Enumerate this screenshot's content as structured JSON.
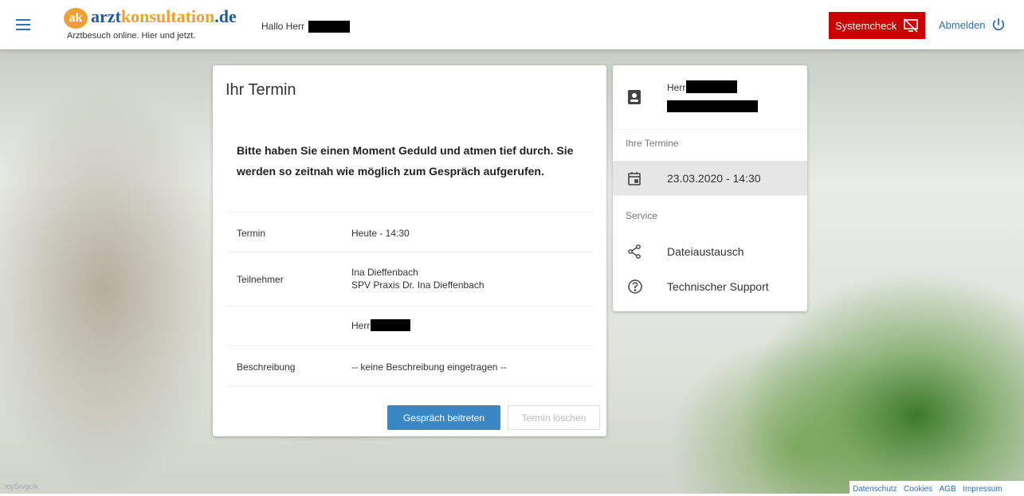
{
  "header": {
    "brand_ak": "ak",
    "brand_part1": "arzt",
    "brand_part2": "konsultation",
    "brand_part3": ".de",
    "tagline": "Arztbesuch online. Hier und jetzt.",
    "greeting": "Hallo Herr",
    "syscheck_label": "Systemcheck",
    "logout_label": "Abmelden"
  },
  "card": {
    "title": "Ihr Termin",
    "message": "Bitte haben Sie einen Moment Geduld und atmen tief durch. Sie werden so zeitnah wie möglich zum Gespräch aufgerufen.",
    "rows": [
      {
        "label": "Termin",
        "value": "Heute - 14:30"
      },
      {
        "label": "Teilnehmer",
        "value": "Ina Dieffenbach",
        "value2": "SPV Praxis Dr. Ina Dieffenbach"
      },
      {
        "label": "",
        "value": "Herr"
      },
      {
        "label": "Beschreibung",
        "value": "-- keine Beschreibung eingetragen --"
      }
    ],
    "join_label": "Gespräch beitreten",
    "delete_label": "Termin löschen"
  },
  "side": {
    "user_prefix": "Herr",
    "section_termine": "Ihre Termine",
    "termin_item": "23.03.2020 - 14:30",
    "section_service": "Service",
    "service_items": [
      "Dateiaustausch",
      "Technischer Support"
    ]
  },
  "footer": {
    "links": [
      "Datenschutz",
      "Cookies",
      "AGB",
      "Impressum"
    ]
  },
  "photo_credit": "toySrvgcik",
  "colors": {
    "accent": "#2d72b5",
    "syscheck_red": "#cc0000",
    "join_blue": "#3b87c6",
    "brand_orange": "#f0a030"
  }
}
